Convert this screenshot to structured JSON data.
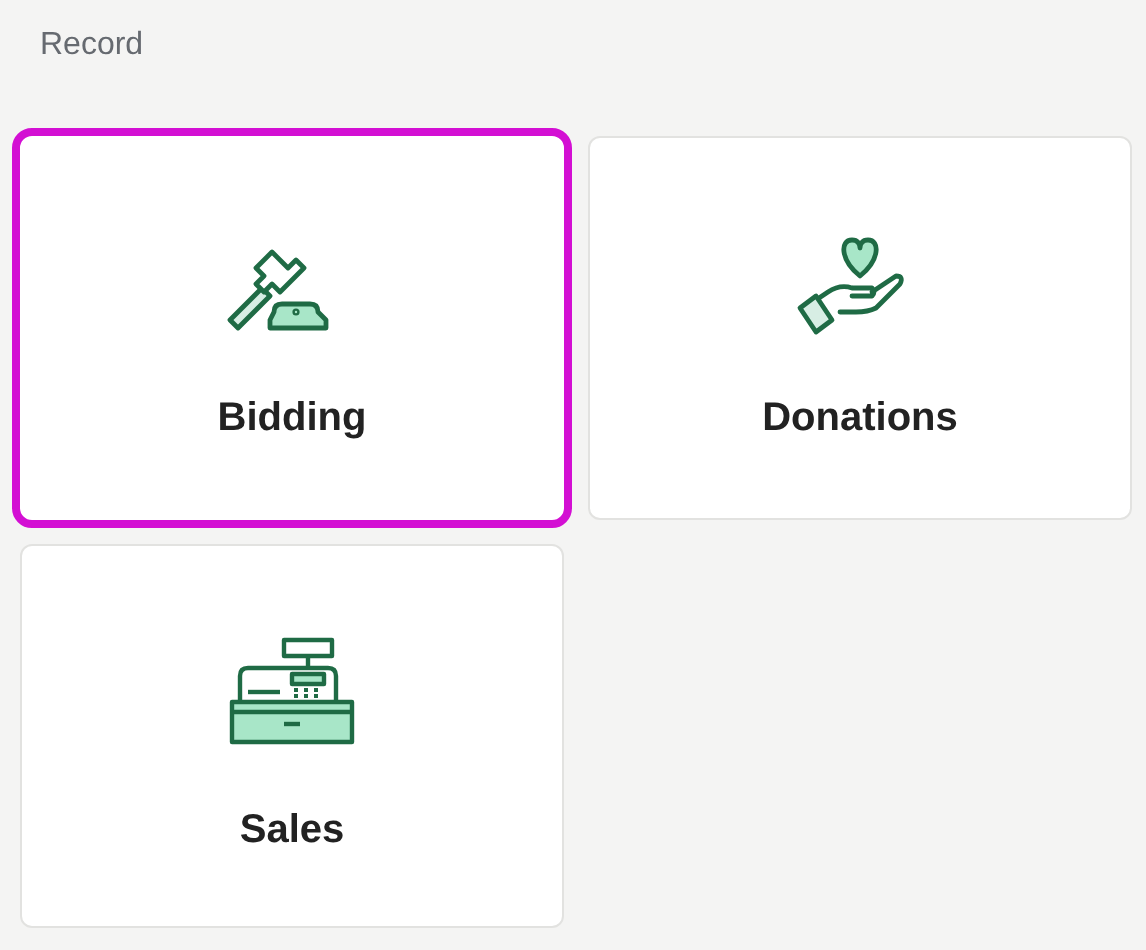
{
  "section": {
    "title": "Record"
  },
  "cards": [
    {
      "label": "Bidding",
      "kind": "gavel",
      "selected": true
    },
    {
      "label": "Donations",
      "kind": "donation",
      "selected": false
    },
    {
      "label": "Sales",
      "kind": "register",
      "selected": false
    }
  ]
}
